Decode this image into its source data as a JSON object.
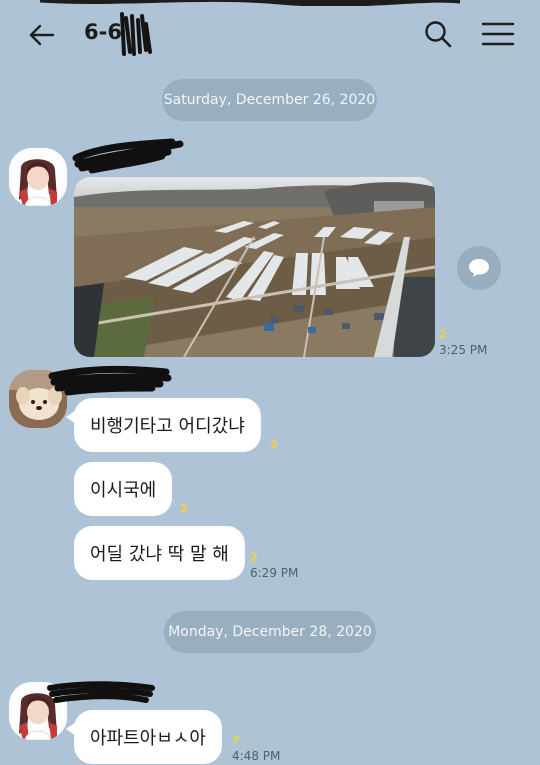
{
  "header": {
    "title": "6-6",
    "back_icon": "arrow-left-icon",
    "search_icon": "search-icon",
    "menu_icon": "hamburger-menu-icon"
  },
  "colors": {
    "background": "#aec3d5",
    "date_pill": "#99aebf",
    "bubble": "#ffffff",
    "unread": "#f4d23a"
  },
  "chat": {
    "dates": [
      "Saturday, December 26, 2020",
      "Monday, December 28, 2020"
    ],
    "photo_message": {
      "unread": "2",
      "time": "3:25 PM",
      "share_icon": "share-bubble-icon"
    },
    "messages": [
      {
        "text": "비행기타고 어디갔냐",
        "unread": "2",
        "time": ""
      },
      {
        "text": "이시국에",
        "unread": "2",
        "time": ""
      },
      {
        "text": "어딜 갔냐 딱 말 해",
        "unread": "2",
        "time": "6:29 PM"
      },
      {
        "text": "아파트아ㅂㅅ아",
        "unread": "7",
        "time": "4:48 PM"
      }
    ]
  }
}
